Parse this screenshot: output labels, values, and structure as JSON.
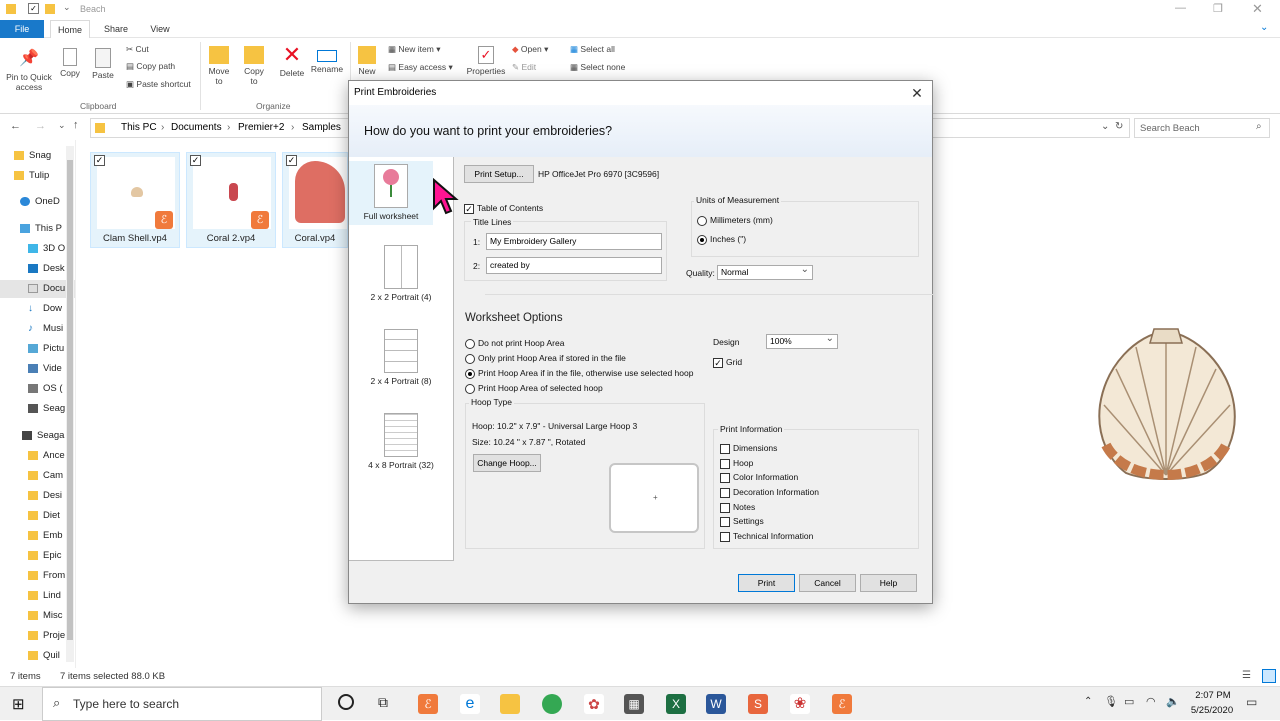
{
  "window": {
    "title": "Beach"
  },
  "ribbon": {
    "tabs": [
      "File",
      "Home",
      "Share",
      "View"
    ],
    "clipboard": {
      "pin": "Pin to Quick access",
      "copy": "Copy",
      "paste": "Paste",
      "cut": "Cut",
      "copy_path": "Copy path",
      "paste_shortcut": "Paste shortcut",
      "group": "Clipboard"
    },
    "organize": {
      "move": "Move to",
      "copy": "Copy to",
      "delete": "Delete",
      "rename": "Rename",
      "group": "Organize"
    },
    "new": {
      "new": "New",
      "new_item": "New item",
      "easy_access": "Easy access"
    },
    "open": {
      "properties": "Properties",
      "open": "Open",
      "edit": "Edit",
      "select_all": "Select all",
      "select_none": "Select none"
    }
  },
  "address": {
    "crumbs": [
      "This PC",
      "Documents",
      "Premier+2",
      "Samples"
    ],
    "search_placeholder": "Search Beach"
  },
  "nav": {
    "items": [
      "Snag",
      "Tulip",
      "OneD",
      "This P",
      "3D O",
      "Desk",
      "Docu",
      "Dow",
      "Musi",
      "Pictu",
      "Vide",
      "OS (",
      "Seag",
      "Seaga",
      "Ance",
      "Cam",
      "Desi",
      "Diet",
      "Emb",
      "Epic",
      "From",
      "Lind",
      "Misc",
      "Proje",
      "Quil"
    ]
  },
  "files": [
    {
      "name": "Clam Shell.vp4"
    },
    {
      "name": "Coral 2.vp4"
    },
    {
      "name": "Coral.vp4"
    }
  ],
  "status": {
    "count": "7 items",
    "selected": "7 items selected  88.0 KB"
  },
  "dialog": {
    "title": "Print Embroideries",
    "header": "How do you want to print your embroideries?",
    "layouts": [
      "Full worksheet",
      "2 x 2 Portrait (4)",
      "2 x 4 Portrait (8)",
      "4 x 8 Portrait (32)"
    ],
    "print_setup": "Print Setup...",
    "printer": "HP OfficeJet Pro 6970 [3C9596]",
    "toc": "Table of Contents",
    "title_lines_label": "Title Lines",
    "line1_label": "1:",
    "line1": "My Embroidery Gallery",
    "line2_label": "2:",
    "line2": "created by",
    "units_label": "Units of Measurement",
    "mm": "Millimeters (mm)",
    "inches": "Inches (\")",
    "quality_label": "Quality:",
    "quality": "Normal",
    "worksheet_options": "Worksheet Options",
    "hoop_opts": [
      "Do not print Hoop Area",
      "Only print Hoop Area if stored in the file",
      "Print Hoop Area if in the file, otherwise use selected hoop",
      "Print Hoop Area of selected hoop"
    ],
    "design_label": "Design",
    "design": "100%",
    "grid": "Grid",
    "hoop_type": "Hoop Type",
    "hoop": "Hoop:   10.2\" x 7.9\" - Universal Large Hoop 3",
    "size": "Size:   10.24 \" x 7.87 \", Rotated",
    "change_hoop": "Change Hoop...",
    "print_info": "Print Information",
    "info_items": [
      "Dimensions",
      "Hoop",
      "Color Information",
      "Decoration Information",
      "Notes",
      "Settings",
      "Technical Information"
    ],
    "buttons": {
      "print": "Print",
      "cancel": "Cancel",
      "help": "Help"
    }
  },
  "taskbar": {
    "search": "Type here to search",
    "time": "2:07 PM",
    "date": "5/25/2020"
  },
  "colors": {
    "accent": "#0078d7",
    "file_tab": "#1979ca",
    "delete": "#e81123",
    "folder": "#f6c342"
  }
}
